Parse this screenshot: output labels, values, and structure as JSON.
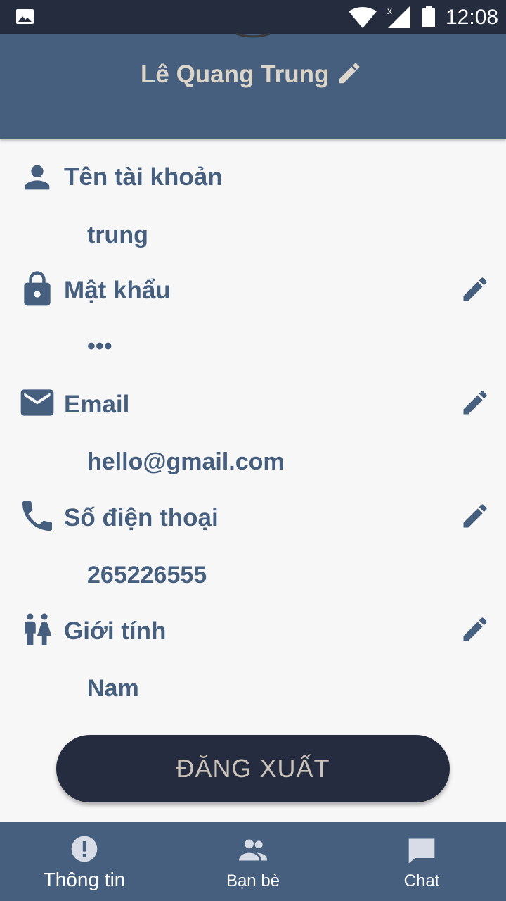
{
  "status_bar": {
    "time": "12:08"
  },
  "header": {
    "name": "Lê Quang Trung"
  },
  "fields": [
    {
      "label": "Tên tài khoản",
      "value": "trung",
      "icon": "person-icon",
      "editable": false
    },
    {
      "label": "Mật khẩu",
      "value": "•••",
      "icon": "lock-icon",
      "editable": true
    },
    {
      "label": "Email",
      "value": "hello@gmail.com",
      "icon": "mail-icon",
      "editable": true
    },
    {
      "label": "Số điện thoại",
      "value": "265226555",
      "icon": "phone-icon",
      "editable": true
    },
    {
      "label": "Giới tính",
      "value": "Nam",
      "icon": "gender-icon",
      "editable": true
    }
  ],
  "logout_label": "ĐĂNG XUẤT",
  "nav": [
    {
      "label": "Thông tin",
      "icon": "info-icon",
      "active": true
    },
    {
      "label": "Bạn bè",
      "icon": "friends-icon",
      "active": false
    },
    {
      "label": "Chat",
      "icon": "chat-icon",
      "active": false
    }
  ],
  "colors": {
    "primary": "#465f7e",
    "dark": "#252c3e",
    "accent_text": "#dcd5c9",
    "background": "#f7f7f8"
  }
}
